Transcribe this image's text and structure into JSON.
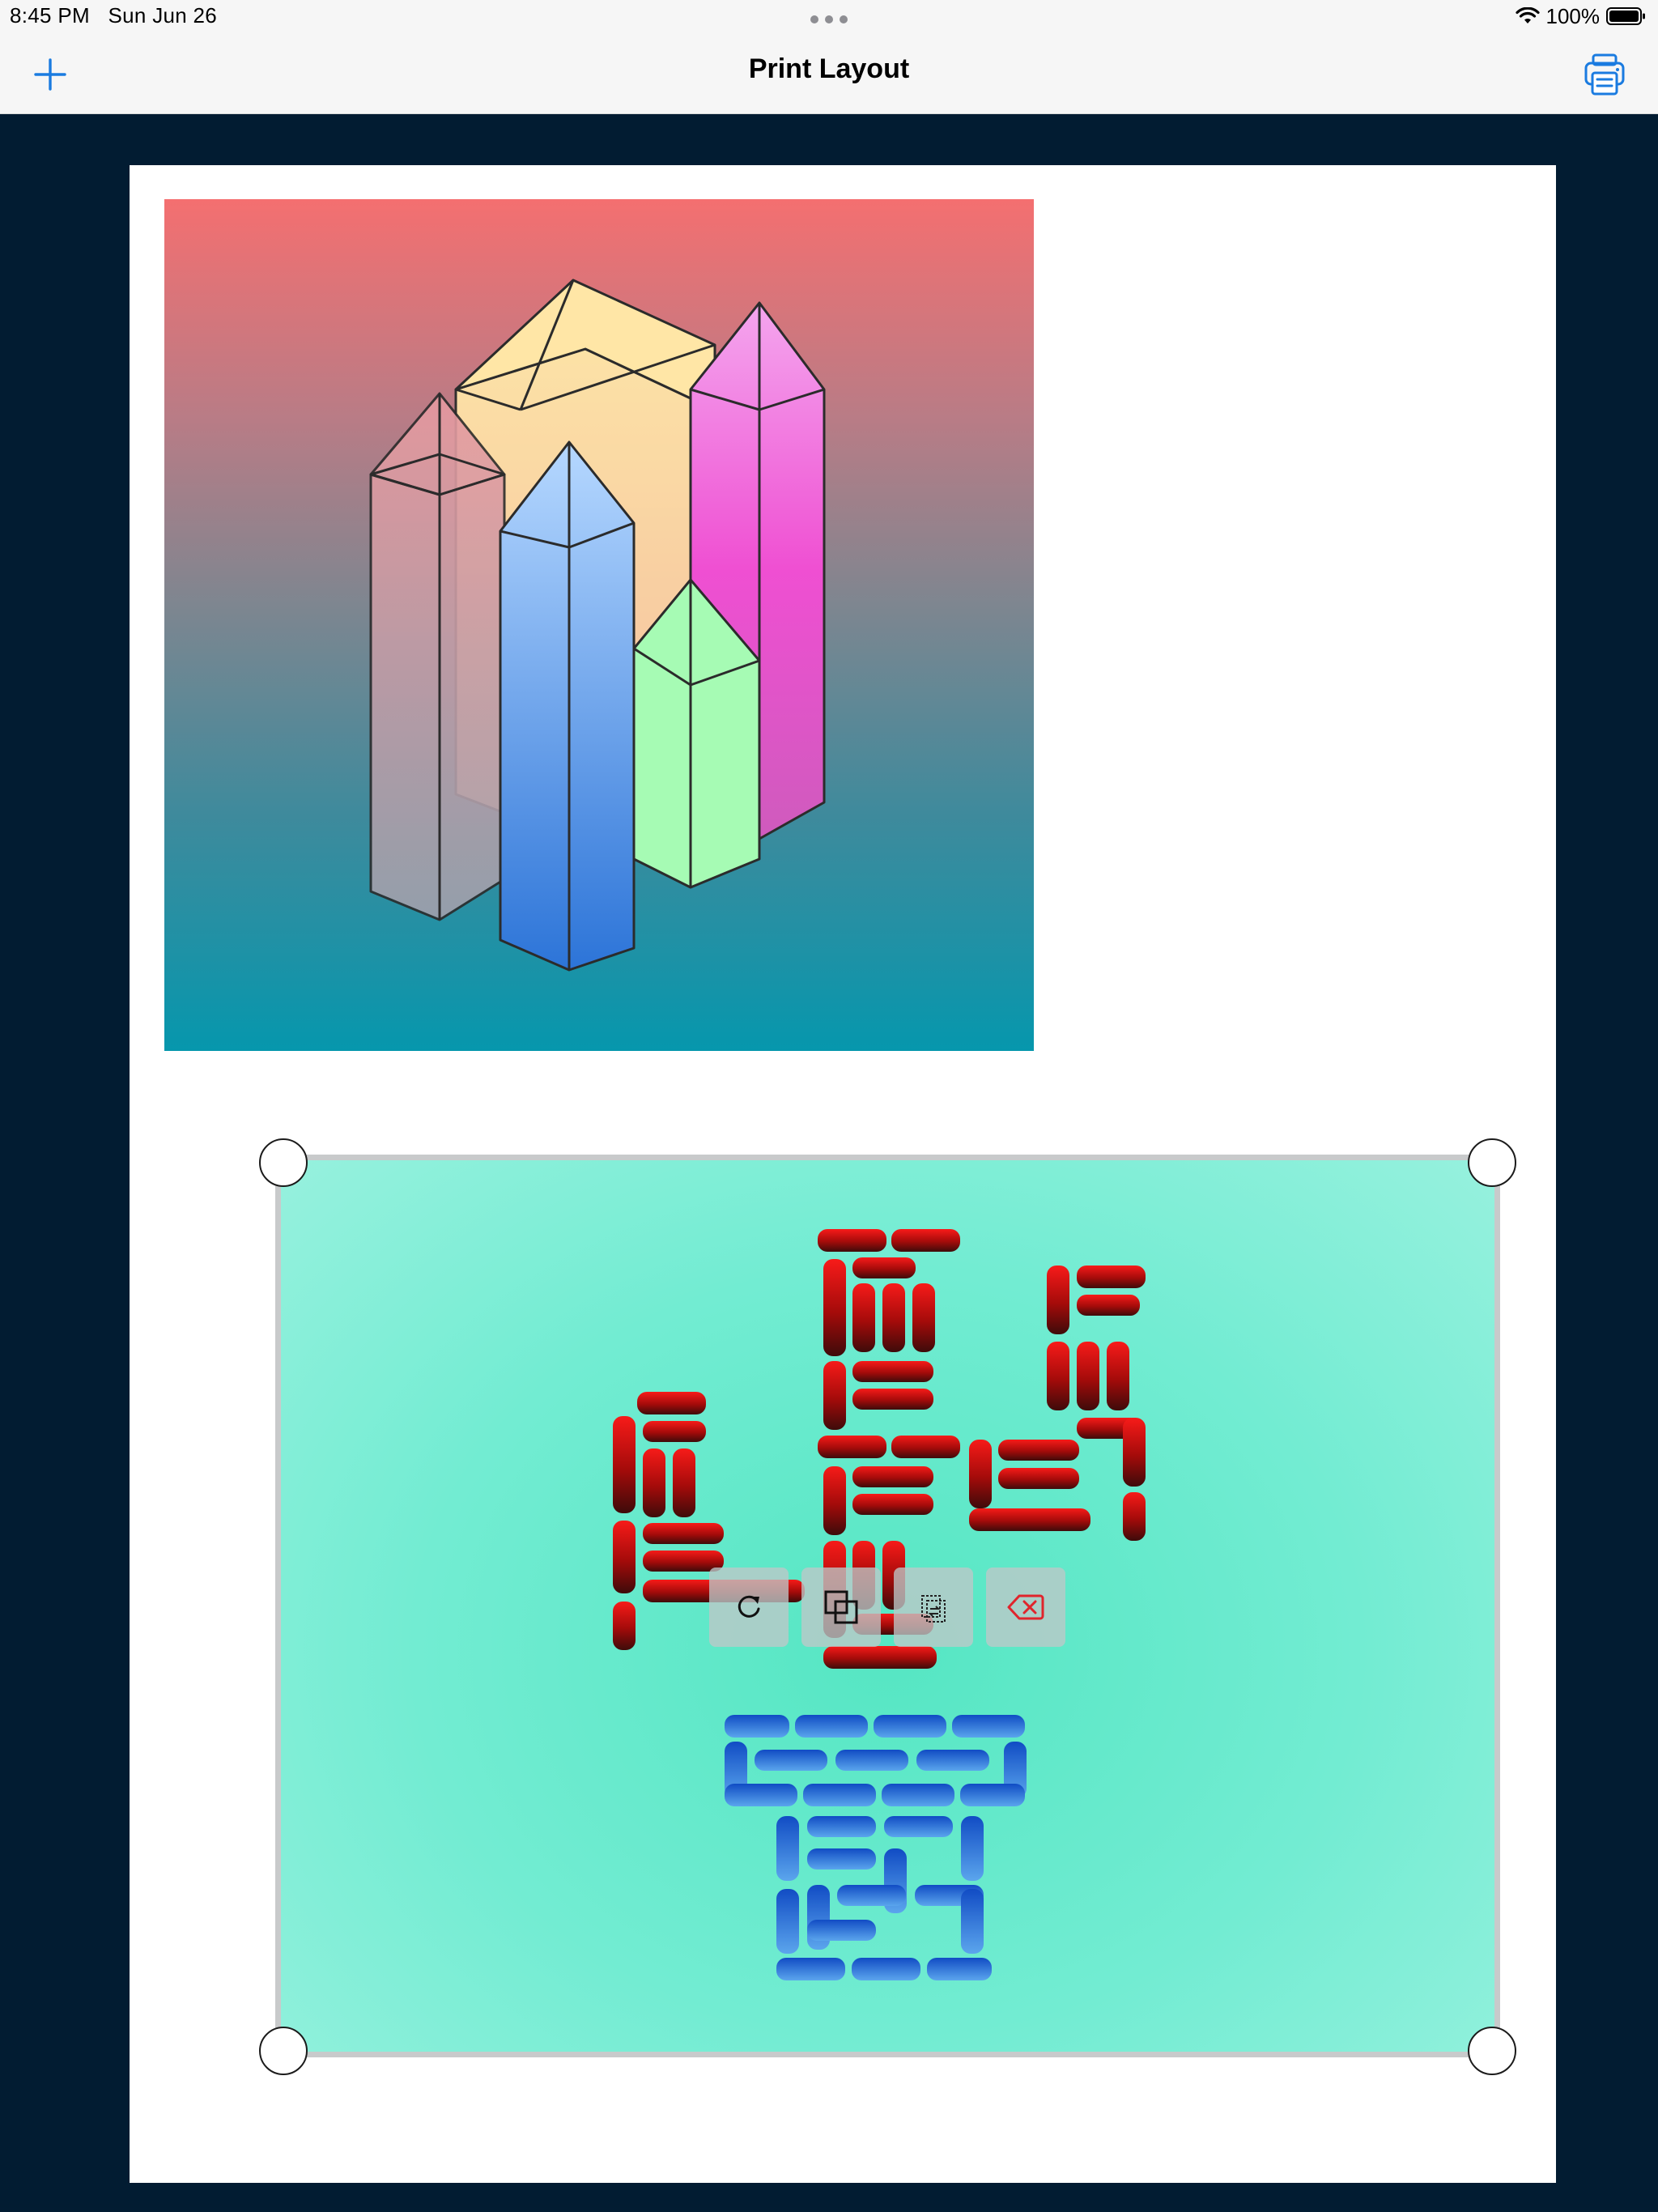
{
  "status": {
    "time": "8:45 PM",
    "date": "Sun Jun 26",
    "battery": "100%",
    "wifi_icon": "wifi-icon",
    "battery_icon": "battery-icon"
  },
  "nav": {
    "title": "Print Layout",
    "add_icon": "plus-icon",
    "print_icon": "printer-icon"
  },
  "colors": {
    "accent": "#1a7be0",
    "background": "#021c32",
    "page": "#ffffff",
    "delete": "#e0242c"
  },
  "layout_items": [
    {
      "content": "crystal-towers-image",
      "selected": false
    },
    {
      "content": "brick-cactus-image",
      "selected": true
    }
  ],
  "selection_toolbar": {
    "buttons": [
      {
        "name": "rotate",
        "icon": "rotate-icon"
      },
      {
        "name": "duplicate",
        "icon": "duplicate-icon"
      },
      {
        "name": "replace",
        "icon": "replace-icon"
      },
      {
        "name": "delete",
        "icon": "delete-icon"
      }
    ]
  }
}
